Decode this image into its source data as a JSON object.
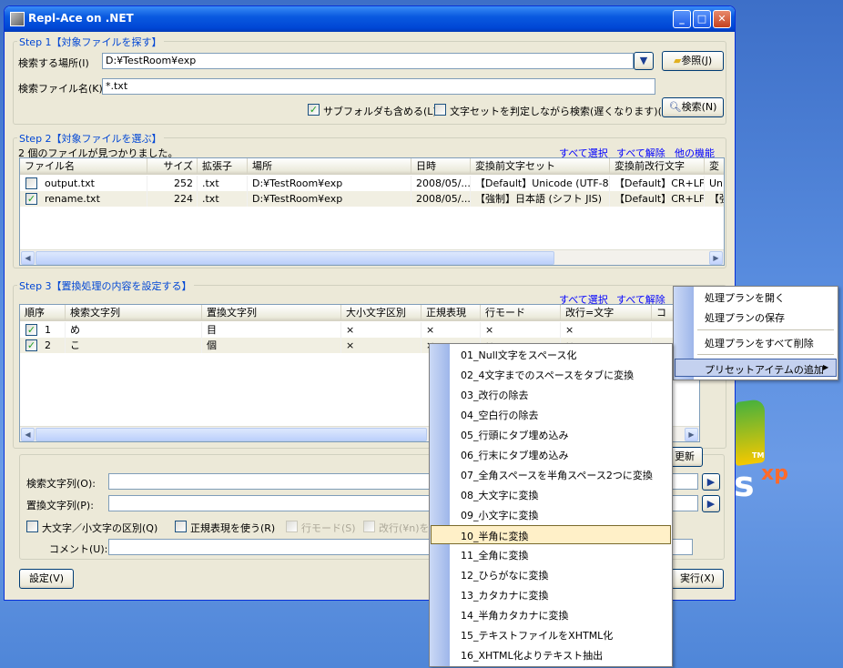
{
  "window": {
    "title": "Repl-Ace on .NET",
    "min": "_",
    "max": "□",
    "close": "✕"
  },
  "step1": {
    "title": "Step 1【対象ファイルを探す】",
    "location_label": "検索する場所(I)",
    "location_value": "D:¥TestRoom¥exp",
    "browse_button": "参照(J)",
    "filename_label": "検索ファイル名(K)",
    "filename_value": "*.txt",
    "subfolders_label": "サブフォルダも含める(L)",
    "subfolders_checked": true,
    "charset_label": "文字セットを判定しながら検索(遅くなります)(M)",
    "charset_checked": false,
    "search_button": "検索(N)"
  },
  "step2": {
    "title": "Step 2【対象ファイルを選ぶ】",
    "status": "2 個のファイルが見つかりました。",
    "select_all": "すべて選択",
    "deselect_all": "すべて解除",
    "other": "他の機能",
    "columns": [
      "ファイル名",
      "サイズ",
      "拡張子",
      "場所",
      "日時",
      "変換前文字セット",
      "変換前改行文字",
      "変"
    ],
    "rows": [
      {
        "checked": false,
        "name": "output.txt",
        "size": "252",
        "ext": ".txt",
        "location": "D:¥TestRoom¥exp",
        "date": "2008/05/...",
        "charset": "【Default】Unicode (UTF-8)",
        "newline": "【Default】CR+LF...",
        "extra": "Uni"
      },
      {
        "checked": true,
        "name": "rename.txt",
        "size": "224",
        "ext": ".txt",
        "location": "D:¥TestRoom¥exp",
        "date": "2008/05/...",
        "charset": "【強制】日本語 (シフト JIS)",
        "newline": "【Default】CR+LF...",
        "extra": "【強"
      }
    ]
  },
  "step3": {
    "title": "Step 3【置換処理の内容を設定する】",
    "select_all": "すべて選択",
    "deselect_all": "すべて解除",
    "columns": [
      "順序",
      "検索文字列",
      "置換文字列",
      "大小文字区別",
      "正規表現",
      "行モード",
      "改行=文字",
      "コ"
    ],
    "rows": [
      {
        "checked": true,
        "order": "1",
        "search": "め",
        "replace": "目",
        "case": "×",
        "regex": "×",
        "line": "×",
        "newline": "×"
      },
      {
        "checked": true,
        "order": "2",
        "search": "こ",
        "replace": "個",
        "case": "×",
        "regex": "×",
        "line": "×",
        "newline": "×"
      }
    ],
    "update_button": "更新",
    "search_label": "検索文字列(O):",
    "replace_label": "置換文字列(P):",
    "case_label": "大文字／小文字の区別(Q)",
    "regex_label": "正規表現を使う(R)",
    "linemode_label": "行モード(S)",
    "newline_label": "改行(¥n)を文",
    "comment_label": "コメント(U):",
    "run_arrow": "▶"
  },
  "footer": {
    "settings_button": "設定(V)",
    "run_button": "実行(X)"
  },
  "context_menu": {
    "items": [
      "処理プランを開く",
      "処理プランの保存",
      "処理プランをすべて削除",
      "プリセットアイテムの追加"
    ],
    "arrow": "▶"
  },
  "submenu": {
    "items": [
      "01_Null文字をスペース化",
      "02_4文字までのスペースをタブに変換",
      "03_改行の除去",
      "04_空白行の除去",
      "05_行頭にタブ埋め込み",
      "06_行末にタブ埋め込み",
      "07_全角スペースを半角スペース2つに変換",
      "08_大文字に変換",
      "09_小文字に変換",
      "10_半角に変換",
      "11_全角に変換",
      "12_ひらがなに変換",
      "13_カタカナに変換",
      "14_半角カタカナに変換",
      "15_テキストファイルをXHTML化",
      "16_XHTML化よりテキスト抽出"
    ],
    "selected_index": 9
  },
  "desktop": {
    "logo_fragment": "s",
    "logo_xp": "xp",
    "tm": "TM"
  }
}
